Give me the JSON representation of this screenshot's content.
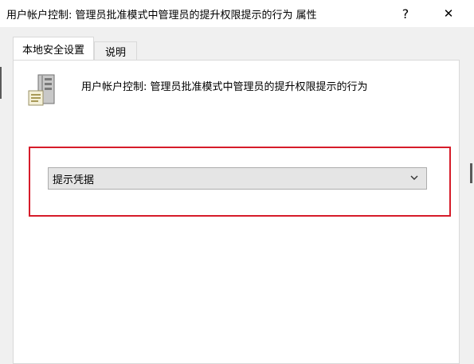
{
  "window": {
    "title": "用户帐户控制: 管理员批准模式中管理员的提升权限提示的行为 属性",
    "help_label": "?",
    "close_label": "✕"
  },
  "tabs": [
    {
      "label": "本地安全设置",
      "active": true
    },
    {
      "label": "说明",
      "active": false
    }
  ],
  "policy": {
    "icon": "server-policy-icon",
    "name": "用户帐户控制: 管理员批准模式中管理员的提升权限提示的行为"
  },
  "dropdown": {
    "selected": "提示凭据",
    "icon": "chevron-down-icon"
  },
  "colors": {
    "highlight": "#d61c2a",
    "titlebar": "#ffffff",
    "panel": "#ffffff",
    "background": "#f0f0f0"
  }
}
